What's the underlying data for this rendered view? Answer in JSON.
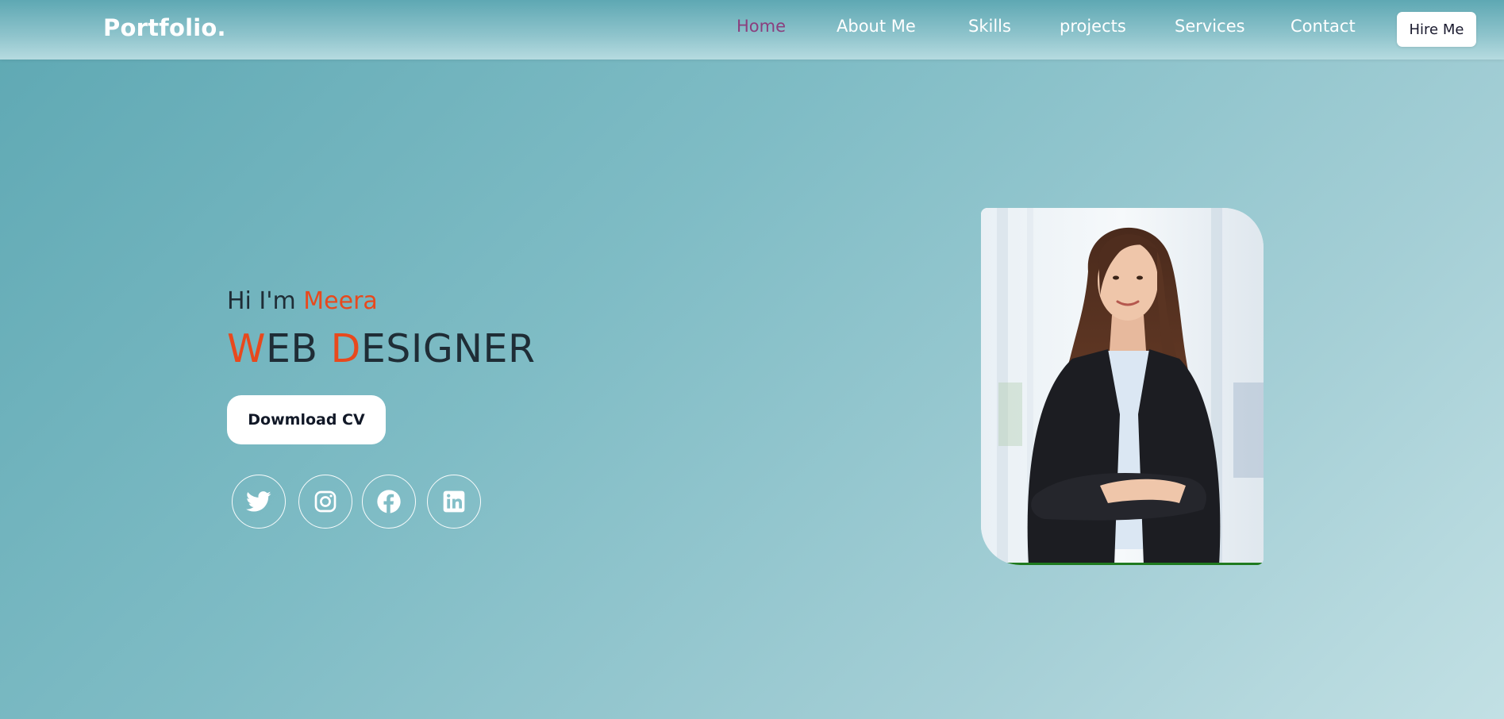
{
  "nav": {
    "logo": "Portfolio.",
    "links": [
      {
        "label": "Home",
        "active": true
      },
      {
        "label": "About Me",
        "active": false
      },
      {
        "label": "Skills",
        "active": false
      },
      {
        "label": "projects",
        "active": false
      },
      {
        "label": "Services",
        "active": false
      },
      {
        "label": "Contact",
        "active": false
      }
    ],
    "hire_label": "Hire Me"
  },
  "hero": {
    "greeting_prefix": "Hi I'm ",
    "name": "Meera",
    "title_first_initial": "W",
    "title_first_rest": "EB ",
    "title_second_initial": "D",
    "title_second_rest": "ESIGNER",
    "cv_label": "Dowmload CV",
    "socials": [
      {
        "icon": "twitter-icon"
      },
      {
        "icon": "instagram-icon"
      },
      {
        "icon": "facebook-icon"
      },
      {
        "icon": "linkedin-icon"
      }
    ]
  },
  "colors": {
    "accent": "#e8491d",
    "nav_active": "#8b3f7e",
    "text_dark": "#1f2d36"
  }
}
